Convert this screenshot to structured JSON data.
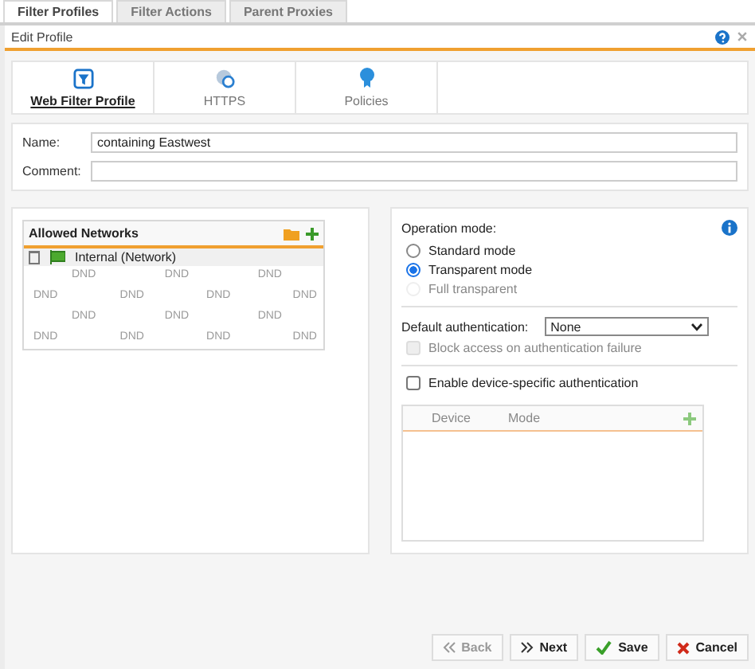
{
  "tabs": [
    {
      "label": "Filter Profiles",
      "selected": true
    },
    {
      "label": "Filter Actions",
      "selected": false
    },
    {
      "label": "Parent Proxies",
      "selected": false
    }
  ],
  "dialog": {
    "title": "Edit Profile"
  },
  "steps": [
    {
      "label": "Web Filter Profile",
      "kind": "filter",
      "selected": true
    },
    {
      "label": "HTTPS",
      "kind": "globe",
      "selected": false
    },
    {
      "label": "Policies",
      "kind": "badge",
      "selected": false
    }
  ],
  "form": {
    "name_label": "Name:",
    "name_value": "containing Eastwest",
    "comment_label": "Comment:"
  },
  "networks": {
    "title": "Allowed Networks",
    "items": [
      {
        "label": "Internal (Network)"
      }
    ],
    "dnd_rows": [
      [
        "DND",
        "DND",
        "DND"
      ],
      [
        "DND",
        "DND",
        "DND",
        "DND"
      ],
      [
        "DND",
        "DND",
        "DND"
      ],
      [
        "DND",
        "DND",
        "DND",
        "DND"
      ]
    ]
  },
  "operation": {
    "label": "Operation mode:",
    "options": [
      {
        "label": "Standard mode",
        "selected": false,
        "disabled": false
      },
      {
        "label": "Transparent mode",
        "selected": true,
        "disabled": false
      },
      {
        "label": "Full transparent",
        "selected": false,
        "disabled": true
      }
    ]
  },
  "auth": {
    "label": "Default authentication:",
    "value": "None",
    "block": {
      "label": "Block access on authentication failure",
      "checked": false,
      "disabled": true
    }
  },
  "device": {
    "enable": {
      "label": "Enable device-specific authentication",
      "checked": false,
      "disabled": false
    },
    "columns": [
      "Device",
      "Mode"
    ]
  },
  "buttons": [
    {
      "label": "Back",
      "kind": "back",
      "disabled": true
    },
    {
      "label": "Next",
      "kind": "next",
      "disabled": false
    },
    {
      "label": "Save",
      "kind": "save",
      "disabled": false
    },
    {
      "label": "Cancel",
      "kind": "cancel",
      "disabled": false
    }
  ]
}
